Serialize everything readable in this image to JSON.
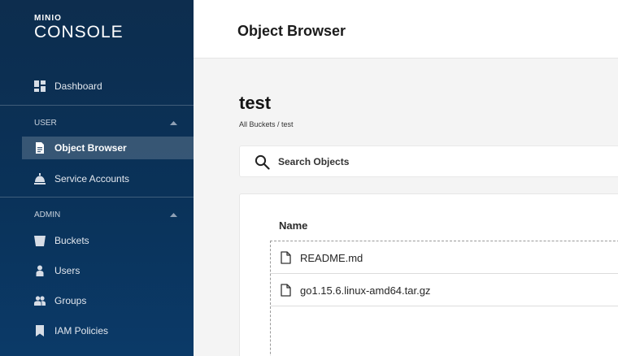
{
  "brand": {
    "top": "MINIO",
    "product": "CONSOLE"
  },
  "sidebar": {
    "dashboard": "Dashboard",
    "user_section": "USER",
    "user_items": [
      {
        "label": "Object Browser",
        "icon": "file-icon",
        "active": true
      },
      {
        "label": "Service Accounts",
        "icon": "service-bell-icon",
        "active": false
      }
    ],
    "admin_section": "ADMIN",
    "admin_items": [
      {
        "label": "Buckets",
        "icon": "bucket-icon"
      },
      {
        "label": "Users",
        "icon": "user-icon"
      },
      {
        "label": "Groups",
        "icon": "group-icon"
      },
      {
        "label": "IAM Policies",
        "icon": "bookmark-icon"
      }
    ]
  },
  "header": {
    "title": "Object Browser"
  },
  "main": {
    "bucket": "test",
    "breadcrumb": "All Buckets / test",
    "search": {
      "placeholder": "Search Objects"
    },
    "table": {
      "column": "Name",
      "rows": [
        "README.md",
        "go1.15.6.linux-amd64.tar.gz"
      ]
    }
  },
  "colors": {
    "sidebar_bg": "#0a3259",
    "active_bg": "#3b5878",
    "page_bg": "#f4f4f4"
  }
}
